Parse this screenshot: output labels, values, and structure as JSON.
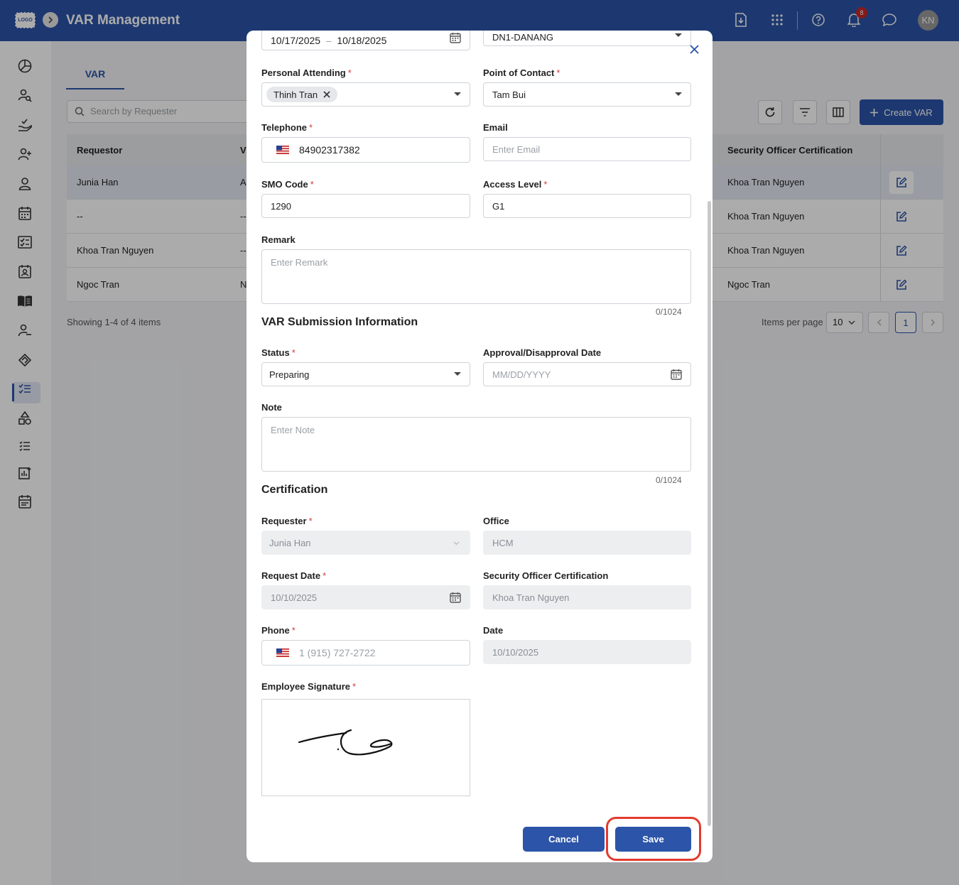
{
  "app": {
    "logo_text": "LOGO",
    "title": "VAR Management",
    "notification_count": "8",
    "avatar_initials": "KN"
  },
  "page": {
    "tab_label": "VAR",
    "search_placeholder": "Search by Requester",
    "create_button": "Create VAR",
    "columns": [
      "Requestor",
      "V",
      "Security Officer Certification"
    ],
    "rows": [
      {
        "requestor": "Junia Han",
        "v": "A",
        "security_officer": "Khoa Tran Nguyen"
      },
      {
        "requestor": "--",
        "v": "--",
        "security_officer": "Khoa Tran Nguyen"
      },
      {
        "requestor": "Khoa Tran Nguyen",
        "v": "--",
        "security_officer": "Khoa Tran Nguyen"
      },
      {
        "requestor": "Ngoc Tran",
        "v": "N",
        "security_officer": "Ngoc Tran"
      }
    ],
    "showing_text": "Showing 1-4 of 4 items",
    "items_per_page_label": "Items per page",
    "items_per_page_value": "10",
    "current_page": "1"
  },
  "modal": {
    "date_range_start": "10/17/2025",
    "date_range_sep": "–",
    "date_range_end": "10/18/2025",
    "location_value": "DN1-DANANG",
    "personal_attending_label": "Personal Attending",
    "personal_attending_chip": "Thinh Tran",
    "point_of_contact_label": "Point of Contact",
    "point_of_contact_value": "Tam Bui",
    "telephone_label": "Telephone",
    "telephone_value": "84902317382",
    "email_label": "Email",
    "email_placeholder": "Enter Email",
    "smo_code_label": "SMO Code",
    "smo_code_value": "1290",
    "access_level_label": "Access Level",
    "access_level_value": "G1",
    "remark_label": "Remark",
    "remark_placeholder": "Enter Remark",
    "remark_counter": "0/1024",
    "submission_section": "VAR Submission Information",
    "status_label": "Status",
    "status_value": "Preparing",
    "approval_date_label": "Approval/Disapproval Date",
    "approval_date_placeholder": "MM/DD/YYYY",
    "note_label": "Note",
    "note_placeholder": "Enter Note",
    "note_counter": "0/1024",
    "certification_section": "Certification",
    "requester_label": "Requester",
    "requester_value": "Junia Han",
    "office_label": "Office",
    "office_value": "HCM",
    "request_date_label": "Request Date",
    "request_date_value": "10/10/2025",
    "security_officer_label": "Security Officer Certification",
    "security_officer_value": "Khoa Tran Nguyen",
    "phone_label": "Phone",
    "phone_value": "1 (915) 727-2722",
    "date_label": "Date",
    "date_value": "10/10/2025",
    "signature_label": "Employee Signature",
    "cancel_label": "Cancel",
    "save_label": "Save"
  },
  "colors": {
    "primary": "#2c54a8",
    "required": "#d23c3c",
    "highlight": "#e23b2e"
  }
}
